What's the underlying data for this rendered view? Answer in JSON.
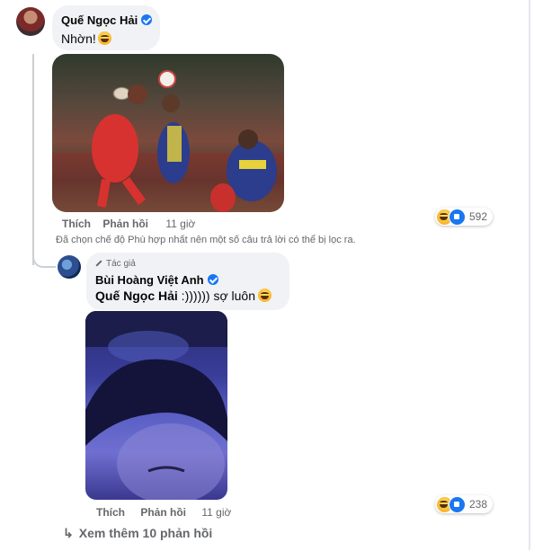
{
  "comment1": {
    "author": "Quế Ngọc Hải",
    "text": "Nhờn!",
    "actions": {
      "like": "Thích",
      "reply": "Phản hồi",
      "time": "11 giờ"
    },
    "reactions": {
      "count": "592",
      "icons": [
        "haha-icon",
        "like-icon"
      ]
    }
  },
  "filter_notice": "Đã chọn chế độ Phù hợp nhất nên một số câu trả lời có thể bị lọc ra.",
  "reply1": {
    "author_badge": "Tác giả",
    "author": "Bùi Hoàng Việt Anh",
    "mention": "Quế Ngọc Hải",
    "text": " :)))))) sợ luôn",
    "actions": {
      "like": "Thích",
      "reply": "Phản hồi",
      "time": "11 giờ"
    },
    "reactions": {
      "count": "238",
      "icons": [
        "haha-icon",
        "like-icon"
      ]
    }
  },
  "more_replies": "Xem thêm 10 phản hồi",
  "colors": {
    "accent": "#1877f2",
    "bubble": "#f0f2f5",
    "muted": "#65676b"
  }
}
